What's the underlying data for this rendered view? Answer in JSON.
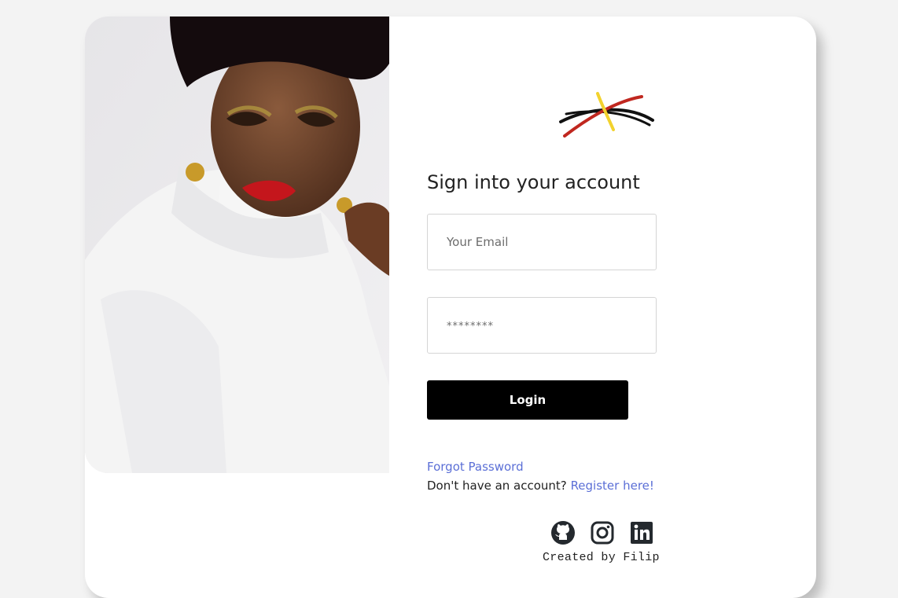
{
  "login": {
    "title": "Sign into your account",
    "email_placeholder": "Your Email",
    "password_placeholder": "********",
    "login_label": "Login",
    "forgot_label": "Forgot Password",
    "register_prompt": "Don't have an account?",
    "register_link": "Register here!"
  },
  "footer": {
    "socials": [
      "github-icon",
      "instagram-icon",
      "linkedin-icon"
    ],
    "credit": "Created by Filip"
  },
  "colors": {
    "link": "#5b6fd6",
    "button": "#000000",
    "logo_red": "#c0271f",
    "logo_yellow": "#f2d22e"
  }
}
